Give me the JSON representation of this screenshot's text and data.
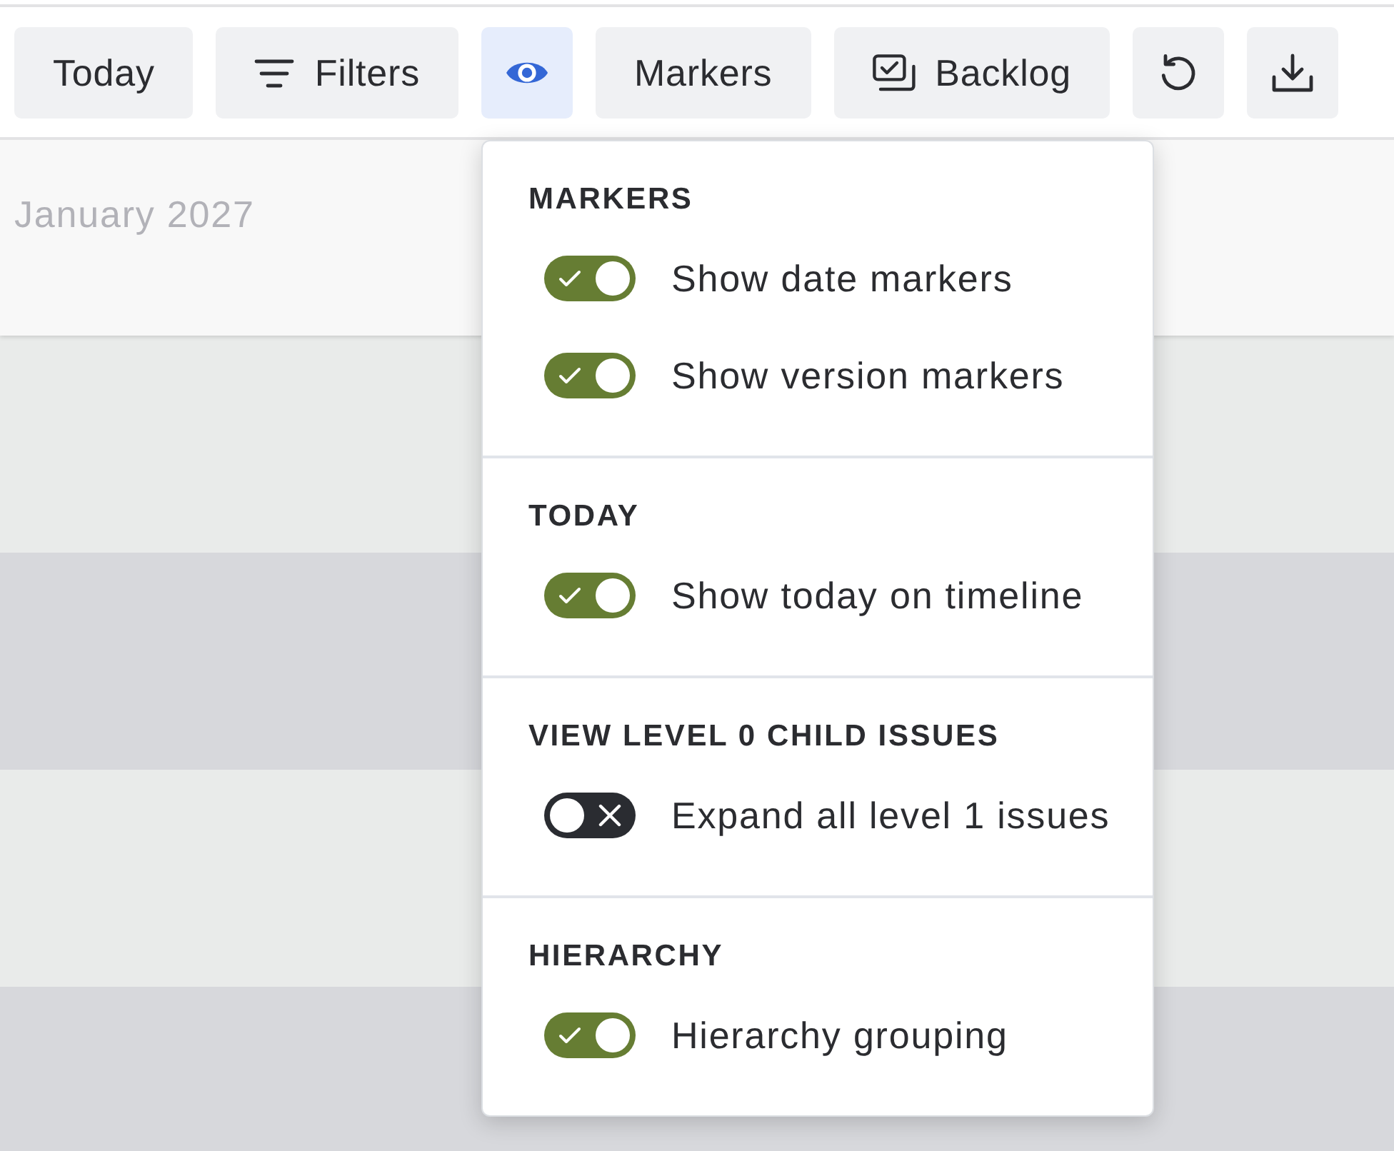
{
  "toolbar": {
    "buttons": [
      {
        "kind": "text",
        "label": "Today",
        "expanded": false
      },
      {
        "kind": "filter",
        "label": "Filters",
        "expanded": false
      },
      {
        "kind": "eye",
        "expanded": true
      },
      {
        "kind": "text",
        "label": "Markers",
        "expanded": false
      },
      {
        "kind": "backlog",
        "label": "Backlog",
        "expanded": false
      },
      {
        "kind": "reset",
        "expanded": false
      },
      {
        "kind": "download",
        "expanded": false
      }
    ]
  },
  "timeline": {
    "month": "January 2027"
  },
  "view_menu": {
    "sections": [
      {
        "heading": "MARKERS",
        "toggles": [
          {
            "label": "Show date markers",
            "on": true
          },
          {
            "label": "Show version markers",
            "on": true
          }
        ]
      },
      {
        "heading": "TODAY",
        "toggles": [
          {
            "label": "Show today on timeline",
            "on": true
          }
        ]
      },
      {
        "heading": "VIEW LEVEL 0 CHILD ISSUES",
        "toggles": [
          {
            "label": "Expand all level 1 issues",
            "on": false
          }
        ]
      },
      {
        "heading": "HIERARCHY",
        "toggles": [
          {
            "label": "Hierarchy grouping",
            "on": true
          }
        ]
      }
    ]
  }
}
